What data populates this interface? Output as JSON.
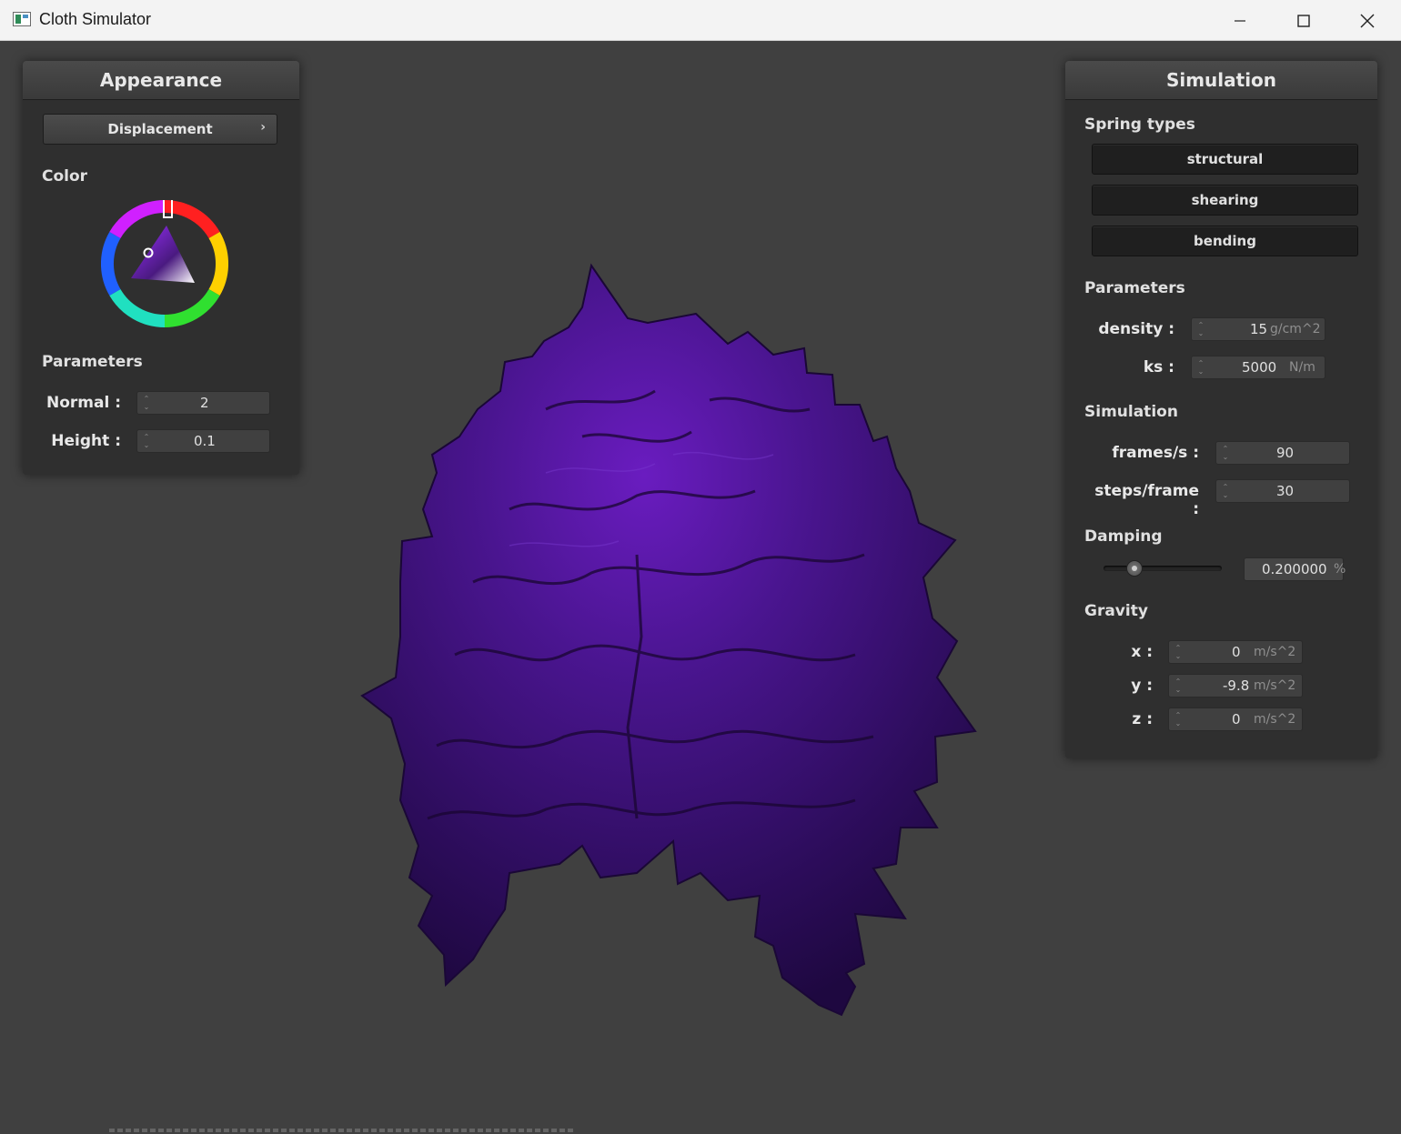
{
  "window": {
    "title": "Cloth Simulator",
    "minimize_glyph": "—",
    "maximize_glyph": "☐",
    "close_glyph": "✕"
  },
  "appearance": {
    "header": "Appearance",
    "shader_button": "Displacement",
    "shader_chevron": "›",
    "color_label": "Color",
    "selected_color": "#3b1470",
    "params_label": "Parameters",
    "normal_label": "Normal :",
    "normal_value": "2",
    "height_label": "Height :",
    "height_value": "0.1"
  },
  "simulation": {
    "header": "Simulation",
    "spring_types_label": "Spring types",
    "spring_buttons": [
      "structural",
      "shearing",
      "bending"
    ],
    "params_label": "Parameters",
    "density_label": "density :",
    "density_value": "15",
    "density_unit": "g/cm^2",
    "ks_label": "ks :",
    "ks_value": "5000",
    "ks_unit": "N/m",
    "simulation_label": "Simulation",
    "fps_label": "frames/s :",
    "fps_value": "90",
    "steps_label": "steps/frame :",
    "steps_value": "30",
    "damping_label": "Damping",
    "damping_value": "0.200000",
    "damping_unit": "%",
    "damping_fraction": 0.2,
    "gravity_label": "Gravity",
    "gx_label": "x :",
    "gx_value": "0",
    "gy_label": "y :",
    "gy_value": "-9.8",
    "gz_label": "z :",
    "gz_value": "0",
    "gravity_unit": "m/s^2"
  },
  "cloth_color": "#3b1470"
}
